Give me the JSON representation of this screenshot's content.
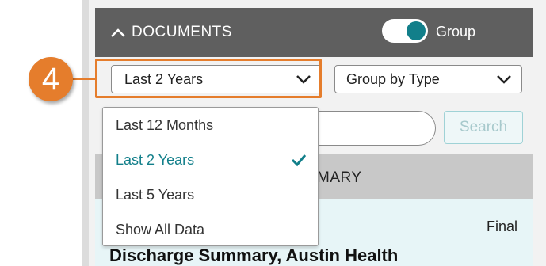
{
  "annotation": {
    "step_number": "4",
    "color": "#e57d2c"
  },
  "header": {
    "title": "DOCUMENTS",
    "collapse_icon": "chevron-up-icon",
    "group_toggle": {
      "label": "Group",
      "on": true,
      "color": "#127f8a"
    }
  },
  "filters": {
    "range_select": {
      "value": "Last 2 Years",
      "icon": "chevron-down-icon"
    },
    "group_select": {
      "value": "Group by Type",
      "icon": "chevron-down-icon"
    }
  },
  "search": {
    "placeholder": "",
    "button_label": "Search"
  },
  "dropdown": {
    "options": [
      {
        "label": "Last 12 Months",
        "selected": false
      },
      {
        "label": "Last 2 Years",
        "selected": true
      },
      {
        "label": "Last 5 Years",
        "selected": false
      },
      {
        "label": "Show All Data",
        "selected": false
      }
    ],
    "selected_icon": "checkmark-icon"
  },
  "section": {
    "header_visible_text": "MARY"
  },
  "document": {
    "status": "Final",
    "title": "Discharge Summary, Austin Health"
  }
}
